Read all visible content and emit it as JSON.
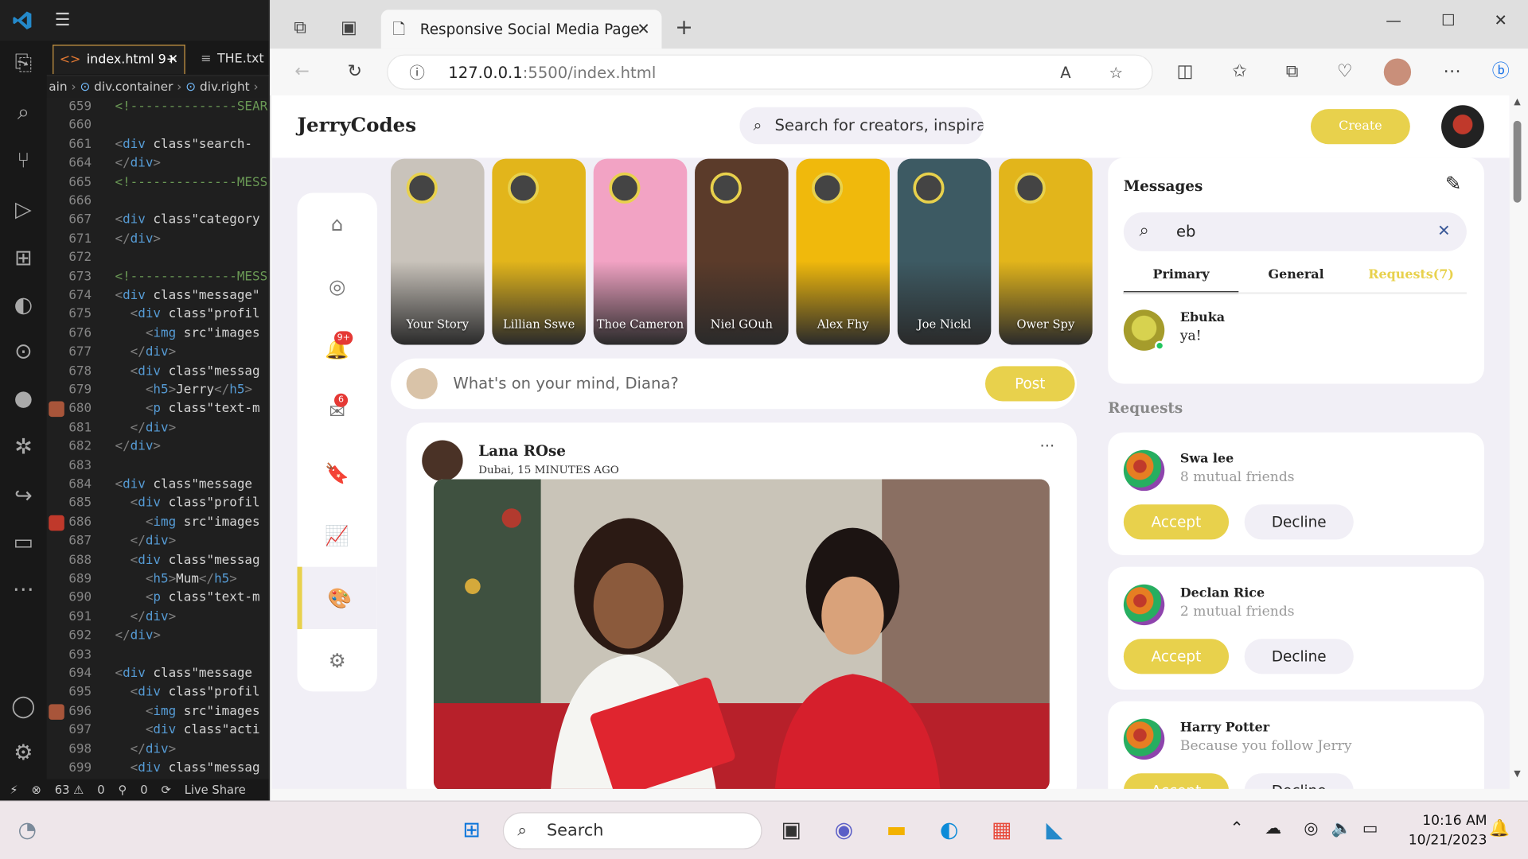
{
  "vscode": {
    "tabs": [
      {
        "label": "index.html 9+"
      },
      {
        "label": "THE.txt"
      }
    ],
    "breadcrumb": [
      "ain",
      "div.container",
      "div.right"
    ],
    "lines": [
      {
        "n": "659",
        "text": "<!--------------SEAR"
      },
      {
        "n": "660",
        "text": ""
      },
      {
        "n": "661",
        "text": "<div class=\"search-"
      },
      {
        "n": "664",
        "text": "</div>"
      },
      {
        "n": "665",
        "text": "<!--------------MESS"
      },
      {
        "n": "666",
        "text": ""
      },
      {
        "n": "667",
        "text": "<div class=\"category"
      },
      {
        "n": "671",
        "text": "</div>"
      },
      {
        "n": "672",
        "text": ""
      },
      {
        "n": "673",
        "text": "<!--------------MESS"
      },
      {
        "n": "674",
        "text": "<div class=\"message\""
      },
      {
        "n": "675",
        "text": "  <div class=\"profil"
      },
      {
        "n": "676",
        "text": "    <img src=\"images"
      },
      {
        "n": "677",
        "text": "  </div>"
      },
      {
        "n": "678",
        "text": "  <div class=\"messag"
      },
      {
        "n": "679",
        "text": "    <h5>Jerry</h5>"
      },
      {
        "n": "680",
        "text": "    <p class=\"text-m"
      },
      {
        "n": "681",
        "text": "  </div>"
      },
      {
        "n": "682",
        "text": "</div>"
      },
      {
        "n": "683",
        "text": ""
      },
      {
        "n": "684",
        "text": "<div class=\"message"
      },
      {
        "n": "685",
        "text": "  <div class=\"profil"
      },
      {
        "n": "686",
        "text": "    <img src=\"images"
      },
      {
        "n": "687",
        "text": "  </div>"
      },
      {
        "n": "688",
        "text": "  <div class=\"messag"
      },
      {
        "n": "689",
        "text": "    <h5>Mum</h5>"
      },
      {
        "n": "690",
        "text": "    <p class=\"text-m"
      },
      {
        "n": "691",
        "text": "  </div>"
      },
      {
        "n": "692",
        "text": "</div>"
      },
      {
        "n": "693",
        "text": ""
      },
      {
        "n": "694",
        "text": "<div class=\"message"
      },
      {
        "n": "695",
        "text": "  <div class=\"profil"
      },
      {
        "n": "696",
        "text": "    <img src=\"images"
      },
      {
        "n": "697",
        "text": "    <div class=\"acti"
      },
      {
        "n": "698",
        "text": "  </div>"
      },
      {
        "n": "699",
        "text": "  <div class=\"messag"
      }
    ],
    "status": {
      "errors": "63",
      "warnings": "0",
      "ports": "0",
      "live_share": "Live Share"
    }
  },
  "browser": {
    "tab_title": "Responsive Social Media Page",
    "url_host": "127.0.0.1",
    "url_path": ":5500/index.html"
  },
  "page": {
    "logo": "JerryCodes",
    "search_placeholder": "Search for creators, inspiral",
    "create_label": "Create",
    "sidebar": [
      {
        "name": "home",
        "icon": "⌂"
      },
      {
        "name": "explore",
        "icon": "◎"
      },
      {
        "name": "notifications",
        "icon": "🔔",
        "badge": "9+"
      },
      {
        "name": "messages",
        "icon": "✉",
        "badge": "6"
      },
      {
        "name": "bookmarks",
        "icon": "🔖"
      },
      {
        "name": "analytics",
        "icon": "📈"
      },
      {
        "name": "theme",
        "icon": "🎨"
      },
      {
        "name": "settings",
        "icon": "⚙"
      }
    ],
    "stories": [
      {
        "name": "Your Story",
        "color": "#c9c3bb"
      },
      {
        "name": "Lillian Sswe",
        "color": "#e2b51b"
      },
      {
        "name": "Thoe Cameron",
        "color": "#f2a3c4"
      },
      {
        "name": "Niel GOuh",
        "color": "#5b3b2a"
      },
      {
        "name": "Alex Fhy",
        "color": "#f0b90c"
      },
      {
        "name": "Joe Nickl",
        "color": "#3d5a63"
      },
      {
        "name": "Ower Spy",
        "color": "#e2b51b"
      }
    ],
    "composer_placeholder": "What's on your mind, Diana?",
    "post_label": "Post",
    "feed": {
      "author": "Lana ROse",
      "meta": "Dubai, 15 MINUTES AGO",
      "more": "···"
    },
    "messages": {
      "title": "Messages",
      "search_value": "eb",
      "tabs": [
        "Primary",
        "General",
        "Requests(7)"
      ],
      "conversation": {
        "name": "Ebuka",
        "text": "ya!"
      }
    },
    "requests": {
      "title": "Requests",
      "accept_label": "Accept",
      "decline_label": "Decline",
      "items": [
        {
          "name": "Swa lee",
          "sub": "8 mutual friends"
        },
        {
          "name": "Declan Rice",
          "sub": "2 mutual friends"
        },
        {
          "name": "Harry Potter",
          "sub": "Because you follow Jerry"
        }
      ]
    }
  },
  "taskbar": {
    "search_label": "Search",
    "time": "10:16 AM",
    "date": "10/21/2023"
  },
  "colors": {
    "accent": "#e8d14c",
    "page_bg": "#f1eff6"
  }
}
